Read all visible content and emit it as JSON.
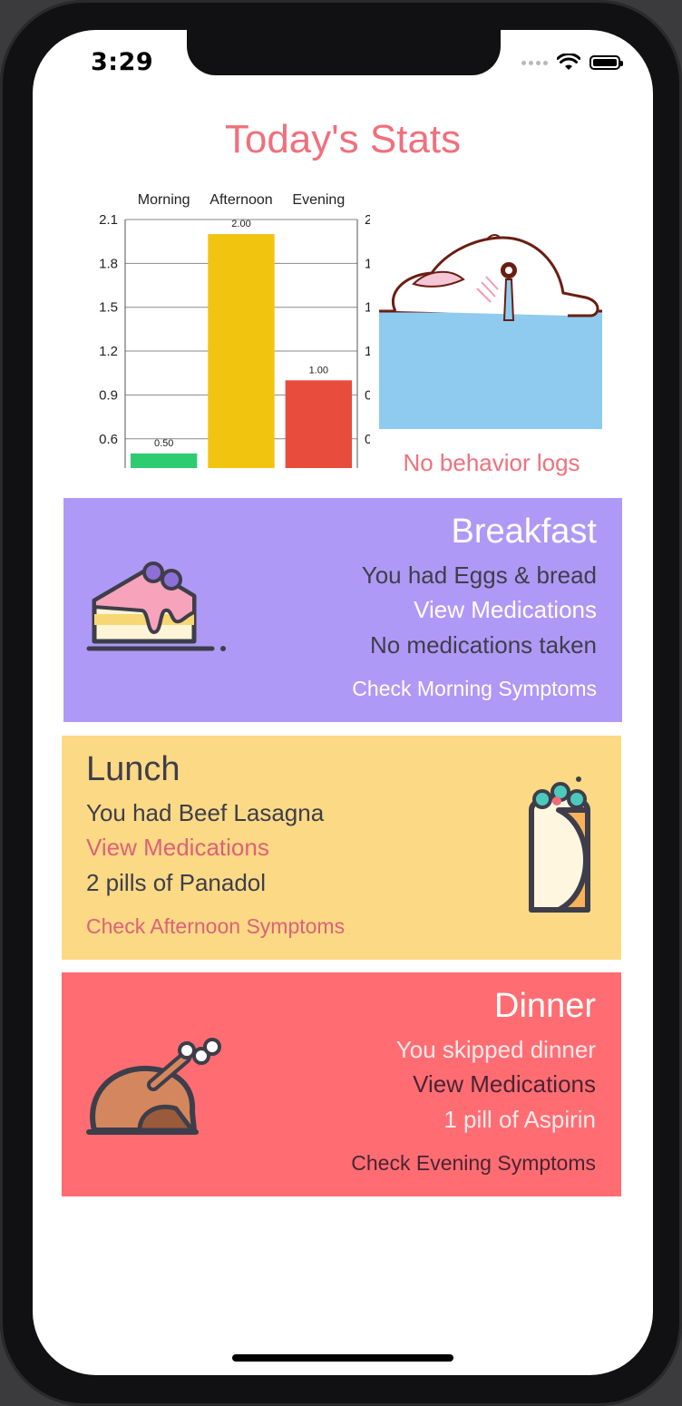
{
  "status_bar": {
    "time": "3:29"
  },
  "page": {
    "title": "Today's Stats"
  },
  "chart_data": {
    "type": "bar",
    "categories": [
      "Morning",
      "Afternoon",
      "Evening"
    ],
    "values": [
      0.5,
      2.0,
      1.0
    ],
    "data_labels": [
      "0.50",
      "2.00",
      "1.00"
    ],
    "colors": [
      "#2ecc71",
      "#f1c40f",
      "#e74c3c"
    ],
    "ylim": [
      0.4,
      2.1
    ],
    "yticks": [
      "2.1",
      "1.8",
      "1.5",
      "1.2",
      "0.9",
      "0.6"
    ],
    "title": "",
    "xlabel": "",
    "ylabel": "",
    "grid": true
  },
  "behavior": {
    "empty_label": "No behavior logs"
  },
  "meals": {
    "breakfast": {
      "heading": "Breakfast",
      "food_text": "You had Eggs & bread",
      "meds_link": "View Medications",
      "meds_text": "No medications taken",
      "symptoms_link": "Check Morning Symptoms",
      "icon": "cake-icon",
      "color": "#af99f6"
    },
    "lunch": {
      "heading": "Lunch",
      "food_text": "You had Beef Lasagna",
      "meds_link": "View Medications",
      "meds_text": "2 pills of Panadol",
      "symptoms_link": "Check Afternoon Symptoms",
      "icon": "burrito-icon",
      "color": "#fbd985"
    },
    "dinner": {
      "heading": "Dinner",
      "food_text": "You skipped dinner",
      "meds_link": "View Medications",
      "meds_text": "1 pill of Aspirin",
      "symptoms_link": "Check Evening Symptoms",
      "icon": "roast-chicken-icon",
      "color": "#ff6d72"
    }
  }
}
